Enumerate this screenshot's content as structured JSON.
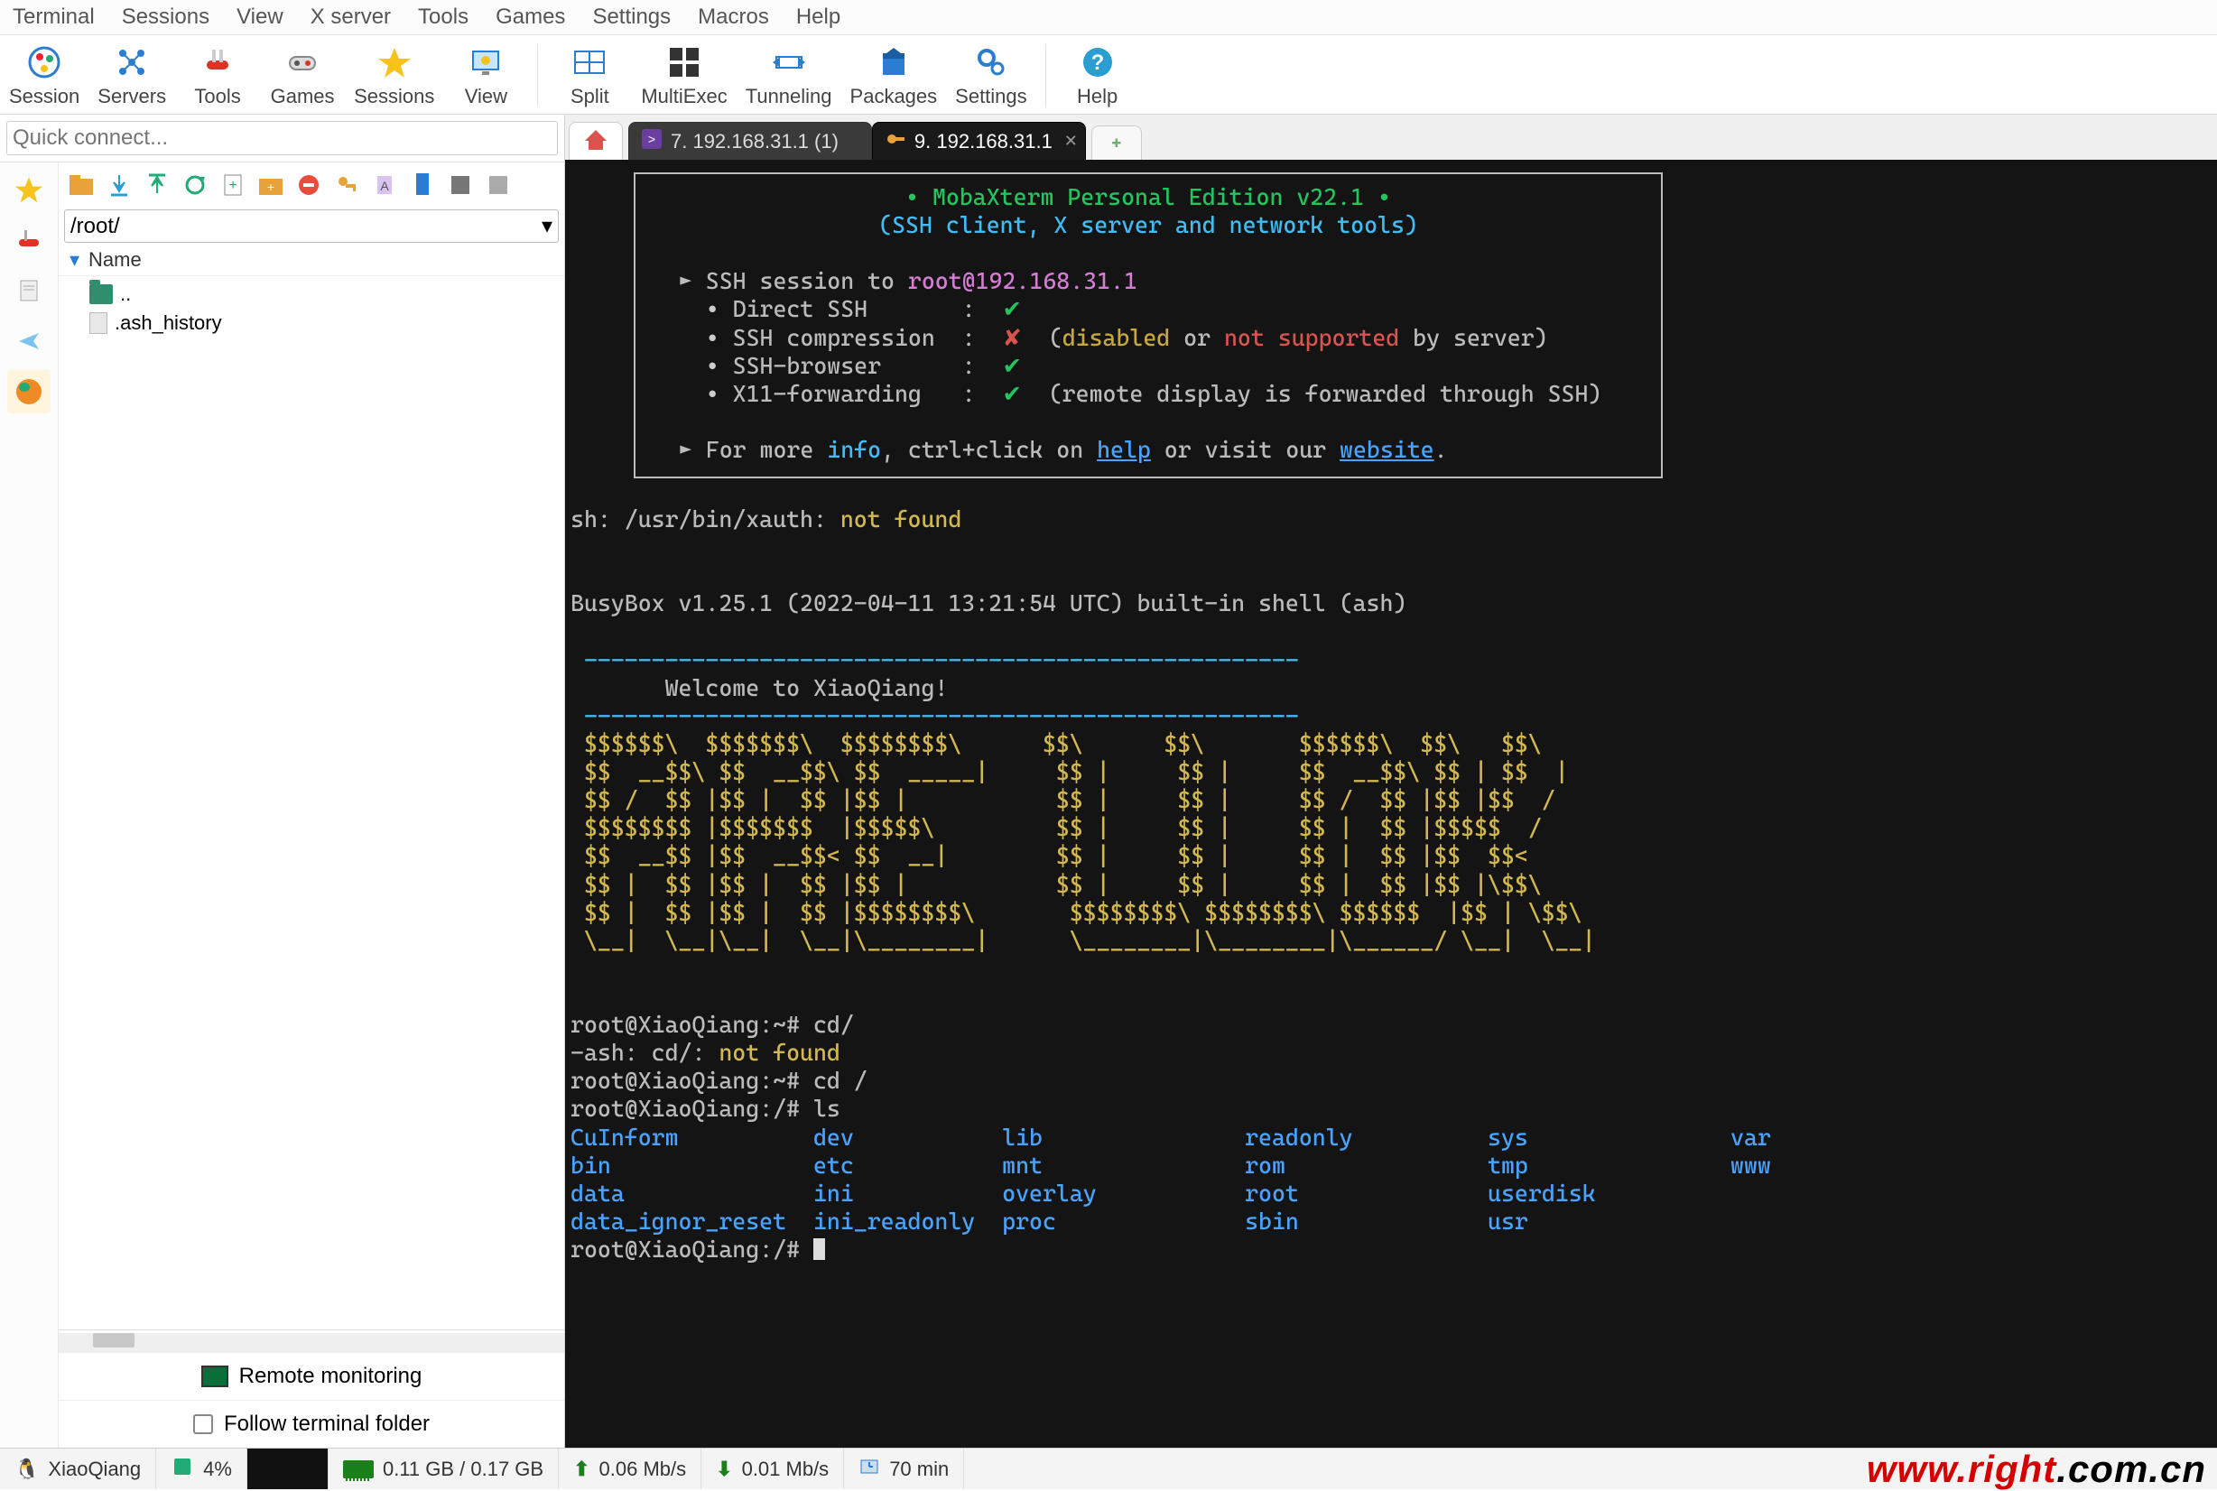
{
  "menubar": [
    "Terminal",
    "Sessions",
    "View",
    "X server",
    "Tools",
    "Games",
    "Settings",
    "Macros",
    "Help"
  ],
  "toolbar": [
    {
      "name": "session",
      "label": "Session",
      "icon": "globe"
    },
    {
      "name": "servers",
      "label": "Servers",
      "icon": "cluster"
    },
    {
      "name": "tools",
      "label": "Tools",
      "icon": "tools"
    },
    {
      "name": "games",
      "label": "Games",
      "icon": "gamepad"
    },
    {
      "name": "sessions",
      "label": "Sessions",
      "icon": "folder"
    },
    {
      "name": "view",
      "label": "View",
      "icon": "eye"
    },
    {
      "name": "split",
      "label": "Split",
      "icon": "split"
    },
    {
      "name": "multiexec",
      "label": "MultiExec",
      "icon": "multi"
    },
    {
      "name": "tunneling",
      "label": "Tunneling",
      "icon": "tunnel"
    },
    {
      "name": "packages",
      "label": "Packages",
      "icon": "package"
    },
    {
      "name": "settings",
      "label": "Settings",
      "icon": "gear"
    },
    {
      "name": "help",
      "label": "Help",
      "icon": "help"
    }
  ],
  "quick_connect_placeholder": "Quick connect...",
  "left_panel": {
    "path": "/root/",
    "name_header": "Name",
    "items": [
      {
        "kind": "parent",
        "label": ".."
      },
      {
        "kind": "file",
        "label": ".ash_history"
      }
    ],
    "remote_monitoring": "Remote monitoring",
    "follow_terminal": "Follow terminal folder"
  },
  "tabs": [
    {
      "name": "home",
      "kind": "home"
    },
    {
      "name": "sess7",
      "kind": "session",
      "label": "7. 192.168.31.1 (1)",
      "active": false,
      "icon": "shell"
    },
    {
      "name": "sess9",
      "kind": "session",
      "label": "9. 192.168.31.1",
      "active": true,
      "icon": "key"
    },
    {
      "name": "new",
      "kind": "new"
    }
  ],
  "terminal": {
    "banner": {
      "title_prefix": "• ",
      "title": "MobaXterm Personal Edition v22.1",
      "title_suffix": " •",
      "subtitle": "(SSH client, X server and network tools)",
      "ssh_line_prefix": "► SSH session to ",
      "ssh_target": "root@192.168.31.1",
      "bullets": [
        {
          "label": "Direct SSH",
          "status": "ok",
          "extra": ""
        },
        {
          "label": "SSH compression",
          "status": "bad",
          "extra_parts": [
            "  (",
            "disabled",
            " or ",
            "not supported",
            " by server)"
          ]
        },
        {
          "label": "SSH-browser",
          "status": "ok",
          "extra": ""
        },
        {
          "label": "X11-forwarding",
          "status": "ok",
          "extra": "  (remote display is forwarded through SSH)"
        }
      ],
      "more_prefix": "► For more ",
      "more_info": "info",
      "more_mid": ", ctrl+click on ",
      "more_help": "help",
      "more_mid2": " or visit our ",
      "more_site": "website",
      "more_end": "."
    },
    "lines": {
      "xauth_a": "sh: /usr/bin/xauth: ",
      "xauth_b": "not found",
      "busybox": "BusyBox v1.25.1 (2022-04-11 13:21:54 UTC) built-in shell (ash)",
      "divider": " -----------------------------------------------------",
      "welcome": "       Welcome to XiaoQiang!",
      "art": [
        " $$$$$$\\  $$$$$$$\\  $$$$$$$$\\      $$\\      $$\\       $$$$$$\\  $$\\   $$\\",
        " $$  __$$\\ $$  __$$\\ $$  _____|     $$ |     $$ |     $$  __$$\\ $$ | $$  |",
        " $$ /  $$ |$$ |  $$ |$$ |           $$ |     $$ |     $$ /  $$ |$$ |$$  /",
        " $$$$$$$$ |$$$$$$$  |$$$$$\\         $$ |     $$ |     $$ |  $$ |$$$$$  /",
        " $$  __$$ |$$  __$$< $$  __|        $$ |     $$ |     $$ |  $$ |$$  $$<",
        " $$ |  $$ |$$ |  $$ |$$ |           $$ |     $$ |     $$ |  $$ |$$ |\\$$\\",
        " $$ |  $$ |$$ |  $$ |$$$$$$$$\\       $$$$$$$$\\ $$$$$$$$\\ $$$$$$  |$$ | \\$$\\",
        " \\__|  \\__|\\__|  \\__|\\________|      \\________|\\________|\\______/ \\__|  \\__|"
      ],
      "p1": "root@XiaoQiang:~# cd/",
      "nf_a": "-ash: cd/: ",
      "nf_b": "not found",
      "p2": "root@XiaoQiang:~# cd /",
      "p3": "root@XiaoQiang:/# ls",
      "ls": [
        [
          "CuInform",
          "dev",
          "lib",
          "readonly",
          "sys",
          "var"
        ],
        [
          "bin",
          "etc",
          "mnt",
          "rom",
          "tmp",
          "www"
        ],
        [
          "data",
          "ini",
          "overlay",
          "root",
          "userdisk",
          ""
        ],
        [
          "data_ignor_reset",
          "ini_readonly",
          "proc",
          "sbin",
          "usr",
          ""
        ]
      ],
      "p4": "root@XiaoQiang:/# "
    }
  },
  "statusbar": {
    "host": "XiaoQiang",
    "cpu_pct": "4%",
    "mem": "0.11 GB / 0.17 GB",
    "up": "0.06 Mb/s",
    "down": "0.01 Mb/s",
    "uptime": "70 min"
  },
  "watermark": {
    "a": "www.right",
    "b": ".com.cn"
  }
}
